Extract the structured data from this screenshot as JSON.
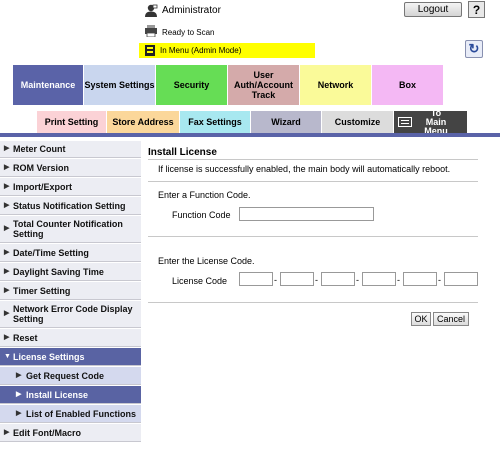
{
  "header": {
    "user_icon": "admin-user-icon",
    "user_label": "Administrator",
    "logout_label": "Logout",
    "help_label": "?",
    "status_icon": "printer-status-icon",
    "status_label": "Ready to Scan",
    "mode_icon": "menu-mode-icon",
    "mode_label": "In Menu (Admin Mode)",
    "refresh_icon": "refresh-icon"
  },
  "tabs_row1": [
    {
      "label": "Maintenance",
      "color": "#5a63a8"
    },
    {
      "label": "System Settings",
      "color": "#c9d6ee"
    },
    {
      "label": "Security",
      "color": "#66dd55"
    },
    {
      "label": "User Auth/Account Track",
      "color": "#d4aaaa"
    },
    {
      "label": "Network",
      "color": "#fafa99"
    },
    {
      "label": "Box",
      "color": "#f4b8f4"
    }
  ],
  "tabs_row2": [
    {
      "label": "Print Setting",
      "color": "#fbd2d6"
    },
    {
      "label": "Store Address",
      "color": "#fbd79a"
    },
    {
      "label": "Fax Settings",
      "color": "#a8e8f0"
    },
    {
      "label": "Wizard",
      "color": "#b8b8cc"
    },
    {
      "label": "Customize",
      "color": "#dcdcdc"
    },
    {
      "label": "To Main Menu",
      "color": "#444444"
    }
  ],
  "sidebar": {
    "items": [
      {
        "label": "Meter Count"
      },
      {
        "label": "ROM Version"
      },
      {
        "label": "Import/Export"
      },
      {
        "label": "Status Notification Setting"
      },
      {
        "label": "Total Counter Notification Setting"
      },
      {
        "label": "Date/Time Setting"
      },
      {
        "label": "Daylight Saving Time"
      },
      {
        "label": "Timer Setting"
      },
      {
        "label": "Network Error Code Display Setting"
      },
      {
        "label": "Reset"
      },
      {
        "label": "License Settings"
      },
      {
        "label": "Get Request Code"
      },
      {
        "label": "Install License"
      },
      {
        "label": "List of Enabled Functions"
      },
      {
        "label": "Edit Font/Macro"
      }
    ]
  },
  "main": {
    "title": "Install License",
    "notice": "If license is successfully enabled, the main body will automatically reboot.",
    "function_prompt": "Enter a Function Code.",
    "function_label": "Function Code",
    "function_value": "",
    "license_prompt": "Enter the License Code.",
    "license_label": "License Code",
    "license_values": [
      "",
      "",
      "",
      "",
      "",
      ""
    ],
    "separator": "-",
    "ok_label": "OK",
    "cancel_label": "Cancel"
  }
}
